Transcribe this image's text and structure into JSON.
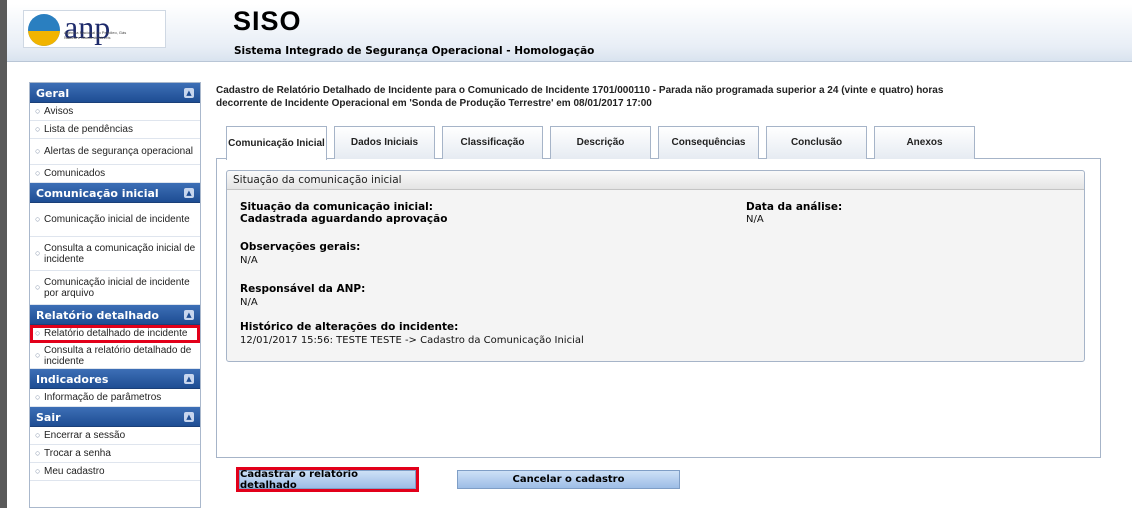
{
  "header": {
    "logo_text": "anp",
    "logo_subtext": "Agência Nacional do Petróleo, Gás Natural e Biocombustíveis",
    "app_title": "SISO",
    "app_subtitle": "Sistema Integrado de Segurança Operacional - Homologação"
  },
  "sidebar": {
    "sections": [
      {
        "title": "Geral",
        "items": [
          "Avisos",
          "Lista de pendências",
          "Alertas de segurança operacional",
          "Comunicados"
        ]
      },
      {
        "title": "Comunicação inicial",
        "items": [
          "Comunicação inicial de incidente",
          "Consulta a comunicação inicial de incidente",
          "Comunicação inicial de incidente por arquivo"
        ]
      },
      {
        "title": "Relatório detalhado",
        "items": [
          "Relatório detalhado de incidente",
          "Consulta a relatório detalhado de incidente"
        ]
      },
      {
        "title": "Indicadores",
        "items": [
          "Informação de parâmetros"
        ]
      },
      {
        "title": "Sair",
        "items": [
          "Encerrar a sessão",
          "Trocar a senha",
          "Meu cadastro"
        ]
      }
    ]
  },
  "main": {
    "title_line1": "Cadastro de Relatório Detalhado de Incidente para o Comunicado de Incidente 1701/000110 - Parada não programada superior a 24 (vinte e quatro) horas",
    "title_line2": "decorrente de Incidente Operacional em 'Sonda de Produção Terrestre' em 08/01/2017 17:00",
    "tabs": [
      "Comunicação Inicial",
      "Dados Iniciais",
      "Classificação",
      "Descrição",
      "Consequências",
      "Conclusão",
      "Anexos"
    ],
    "active_tab": "Comunicação Inicial",
    "box_title": "Situação da comunicação inicial",
    "fields": {
      "situacao_label": "Situação da comunicação inicial:",
      "situacao_value": "Cadastrada aguardando aprovação",
      "data_analise_label": "Data da análise:",
      "data_analise_value": "N/A",
      "observacoes_label": "Observações gerais:",
      "observacoes_value": "N/A",
      "responsavel_label": "Responsável da ANP:",
      "responsavel_value": "N/A",
      "historico_label": "Histórico de alterações do incidente:",
      "historico_value": "12/01/2017 15:56: TESTE TESTE -> Cadastro da Comunicação Inicial"
    },
    "buttons": {
      "submit_label": "Cadastrar o relatório detalhado",
      "cancel_label": "Cancelar o cadastro"
    }
  },
  "colors": {
    "sidebar_header": "#2a5ca3",
    "highlight": "#e2001a",
    "button": "#b5cff0"
  }
}
